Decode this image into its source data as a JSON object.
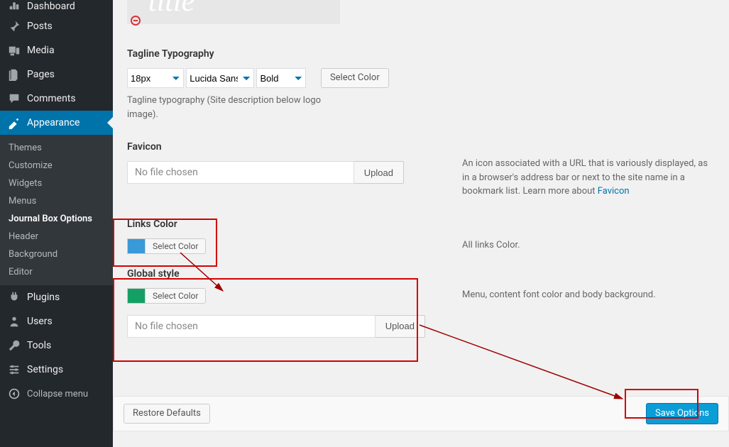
{
  "sidebar": {
    "dashboard": "Dashboard",
    "posts": "Posts",
    "media": "Media",
    "pages": "Pages",
    "comments": "Comments",
    "appearance": "Appearance",
    "appearance_sub": {
      "themes": "Themes",
      "customize": "Customize",
      "widgets": "Widgets",
      "menus": "Menus",
      "journal": "Journal Box Options",
      "header": "Header",
      "background": "Background",
      "editor": "Editor"
    },
    "plugins": "Plugins",
    "users": "Users",
    "tools": "Tools",
    "settings": "Settings",
    "collapse": "Collapse menu"
  },
  "logo_text": "title",
  "tagline": {
    "heading": "Tagline Typography",
    "size": "18px",
    "font": "Lucida Sans",
    "weight": "Bold",
    "select_color": "Select Color",
    "desc": "Tagline typography (Site description below logo image)."
  },
  "favicon": {
    "heading": "Favicon",
    "placeholder": "No file chosen",
    "upload": "Upload",
    "help": "An icon associated with a URL that is variously displayed, as in a browser's address bar or next to the site name in a bookmark list. Learn more about ",
    "link": "Favicon"
  },
  "links": {
    "heading": "Links Color",
    "select": "Select Color",
    "help": "All links Color.",
    "color": "#3a99d8"
  },
  "global": {
    "heading": "Global style",
    "select": "Select Color",
    "placeholder": "No file chosen",
    "upload": "Upload",
    "help": "Menu, content font color and body background.",
    "color": "#14a065"
  },
  "footer": {
    "restore": "Restore Defaults",
    "save": "Save Options"
  }
}
